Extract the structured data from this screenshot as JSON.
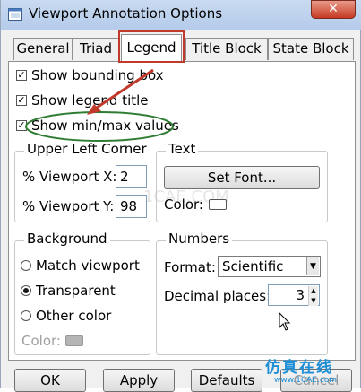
{
  "window": {
    "title": "Viewport Annotation Options",
    "close_glyph": "✕"
  },
  "tabs": [
    {
      "label": "General"
    },
    {
      "label": "Triad"
    },
    {
      "label": "Legend",
      "active": true
    },
    {
      "label": "Title Block"
    },
    {
      "label": "State Block"
    }
  ],
  "legend": {
    "options": [
      {
        "label": "Show bounding box",
        "checked": true
      },
      {
        "label": "Show legend title",
        "checked": true
      },
      {
        "label": "Show min/max values",
        "checked": true
      }
    ],
    "upper_left_corner": {
      "title": "Upper Left Corner",
      "x_label": "% Viewport X:",
      "x_value": "2",
      "y_label": "% Viewport Y:",
      "y_value": "98"
    },
    "text": {
      "title": "Text",
      "set_font_label": "Set Font...",
      "color_label": "Color:"
    },
    "background": {
      "title": "Background",
      "options": [
        {
          "label": "Match viewport",
          "selected": false
        },
        {
          "label": "Transparent",
          "selected": true
        },
        {
          "label": "Other color",
          "selected": false
        }
      ],
      "color_label": "Color:"
    },
    "numbers": {
      "title": "Numbers",
      "format_label": "Format:",
      "format_value": "Scientific",
      "decimal_label": "Decimal places:",
      "decimal_value": "3"
    }
  },
  "buttons": {
    "ok": "OK",
    "apply": "Apply",
    "defaults": "Defaults",
    "cancel": "Cancel"
  },
  "watermark": {
    "text": "仿真在线",
    "url": "www.1CAE.com",
    "faint": "1CAE.COM"
  },
  "colors": {
    "highlight_red": "#c0392b",
    "annotation_green": "#2e7d32",
    "watermark_blue": "#1e8fd6"
  },
  "icons": {
    "app": "viewport-app-icon",
    "arrow": "red-pointer-arrow",
    "cursor": "mouse-cursor-icon"
  }
}
